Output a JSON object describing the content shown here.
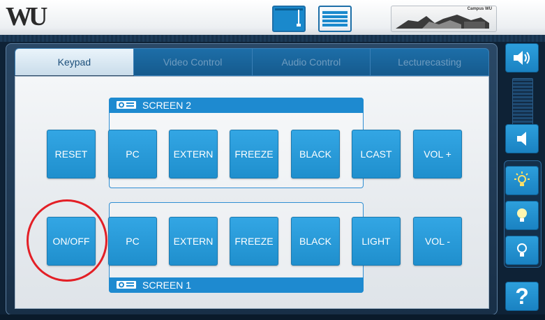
{
  "header": {
    "logo": "WU",
    "campus_label": "Campus WU",
    "buttons": [
      "screen-up-icon",
      "blinds-icon",
      "campus-building-icon"
    ]
  },
  "tabs": [
    {
      "label": "Keypad",
      "active": true
    },
    {
      "label": "Video Control",
      "active": false
    },
    {
      "label": "Audio Control",
      "active": false
    },
    {
      "label": "Lecturecasting",
      "active": false
    }
  ],
  "keypad": {
    "screen2": {
      "title": "SCREEN 2",
      "buttons": [
        "PC",
        "EXTERN",
        "FREEZE",
        "BLACK"
      ]
    },
    "screen1": {
      "title": "SCREEN 1",
      "buttons": [
        "PC",
        "EXTERN",
        "FREEZE",
        "BLACK"
      ]
    },
    "left": {
      "top": "RESET",
      "bottom": "ON/OFF"
    },
    "right_top": [
      "LCAST",
      "VOL +"
    ],
    "right_bottom": [
      "LIGHT",
      "VOL -"
    ]
  },
  "sidebar": {
    "icons": [
      "volume-up-icon",
      "volume-level-meter",
      "volume-down-icon",
      "light-on-icon",
      "light-dim-icon",
      "light-off-icon",
      "help-icon"
    ],
    "help_label": "?"
  },
  "colors": {
    "accent": "#1e8ad0",
    "button": "#2b9ddb",
    "annotation": "#e31f26"
  }
}
